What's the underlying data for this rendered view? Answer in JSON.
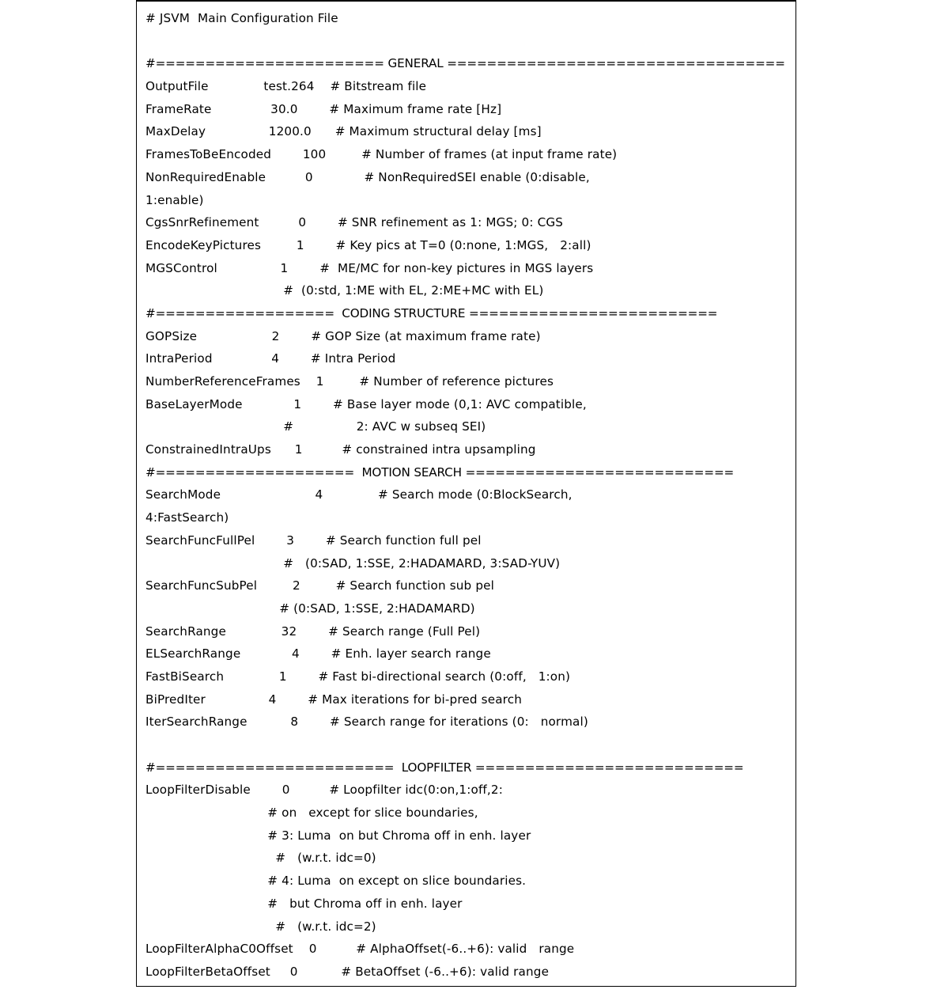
{
  "document": {
    "title": "# JSVM  Main Configuration File",
    "kind": "plain-text-configuration-file",
    "background_color": "#ffffff",
    "text_color": "#000000",
    "border_color": "#000000"
  },
  "lines": [
    {
      "id": "l01",
      "type": "comment",
      "text": "# JSVM  Main Configuration File"
    },
    {
      "id": "l02",
      "type": "blank",
      "text": ""
    },
    {
      "id": "l03",
      "type": "separator",
      "text": "#======================= GENERAL =================================="
    },
    {
      "id": "l04",
      "type": "setting",
      "text": "OutputFile              test.264    # Bitstream file"
    },
    {
      "id": "l05",
      "type": "setting",
      "text": "FrameRate               30.0        # Maximum frame rate [Hz]"
    },
    {
      "id": "l06",
      "type": "setting",
      "text": "MaxDelay                1200.0      # Maximum structural delay [ms]"
    },
    {
      "id": "l07",
      "type": "setting",
      "text": "FramesToBeEncoded        100         # Number of frames (at input frame rate)"
    },
    {
      "id": "l08",
      "type": "setting",
      "text": "NonRequiredEnable          0             # NonRequiredSEI enable (0:disable,"
    },
    {
      "id": "l09",
      "type": "continuation",
      "text": "1:enable)"
    },
    {
      "id": "l10",
      "type": "setting",
      "text": "CgsSnrRefinement          0        # SNR refinement as 1: MGS; 0: CGS"
    },
    {
      "id": "l11",
      "type": "setting",
      "text": "EncodeKeyPictures         1        # Key pics at T=0 (0:none, 1:MGS,   2:all)"
    },
    {
      "id": "l12",
      "type": "setting",
      "text": "MGSControl                1        #  ME/MC for non-key pictures in MGS layers"
    },
    {
      "id": "l13",
      "type": "continuation",
      "text": "                                   #  (0:std, 1:ME with EL, 2:ME+MC with EL)"
    },
    {
      "id": "l14",
      "type": "separator",
      "text": "#==================  CODING STRUCTURE ========================="
    },
    {
      "id": "l15",
      "type": "setting",
      "text": "GOPSize                   2        # GOP Size (at maximum frame rate)"
    },
    {
      "id": "l16",
      "type": "setting",
      "text": "IntraPeriod               4        # Intra Period"
    },
    {
      "id": "l17",
      "type": "setting",
      "text": "NumberReferenceFrames    1         # Number of reference pictures"
    },
    {
      "id": "l18",
      "type": "setting",
      "text": "BaseLayerMode             1        # Base layer mode (0,1: AVC compatible,"
    },
    {
      "id": "l19",
      "type": "continuation",
      "text": "                                   #                2: AVC w subseq SEI)"
    },
    {
      "id": "l20",
      "type": "setting",
      "text": "ConstrainedIntraUps      1          # constrained intra upsampling"
    },
    {
      "id": "l21",
      "type": "separator",
      "text": "#====================  MOTION SEARCH ==========================="
    },
    {
      "id": "l22",
      "type": "setting",
      "text": "SearchMode                        4              # Search mode (0:BlockSearch,"
    },
    {
      "id": "l23",
      "type": "continuation",
      "text": "4:FastSearch)"
    },
    {
      "id": "l24",
      "type": "setting",
      "text": "SearchFuncFullPel        3        # Search function full pel"
    },
    {
      "id": "l25",
      "type": "continuation",
      "text": "                                   #   (0:SAD, 1:SSE, 2:HADAMARD, 3:SAD-YUV)"
    },
    {
      "id": "l26",
      "type": "setting",
      "text": "SearchFuncSubPel         2         # Search function sub pel"
    },
    {
      "id": "l27",
      "type": "continuation",
      "text": "                                  # (0:SAD, 1:SSE, 2:HADAMARD)"
    },
    {
      "id": "l28",
      "type": "setting",
      "text": "SearchRange              32        # Search range (Full Pel)"
    },
    {
      "id": "l29",
      "type": "setting",
      "text": "ELSearchRange             4        # Enh. layer search range"
    },
    {
      "id": "l30",
      "type": "setting",
      "text": "FastBiSearch              1        # Fast bi-directional search (0:off,   1:on)"
    },
    {
      "id": "l31",
      "type": "setting",
      "text": "BiPredIter                4        # Max iterations for bi-pred search"
    },
    {
      "id": "l32",
      "type": "setting",
      "text": "IterSearchRange           8        # Search range for iterations (0:   normal)"
    },
    {
      "id": "l33",
      "type": "blank",
      "text": ""
    },
    {
      "id": "l34",
      "type": "separator",
      "text": "#========================  LOOPFILTER ==========================="
    },
    {
      "id": "l35",
      "type": "setting",
      "text": "LoopFilterDisable        0          # Loopfilter idc(0:on,1:off,2:"
    },
    {
      "id": "l36",
      "type": "continuation",
      "text": "                               # on   except for slice boundaries,"
    },
    {
      "id": "l37",
      "type": "continuation",
      "text": "                               # 3: Luma  on but Chroma off in enh. layer"
    },
    {
      "id": "l38",
      "type": "continuation",
      "text": "                                 #   (w.r.t. idc=0)"
    },
    {
      "id": "l39",
      "type": "continuation",
      "text": "                               # 4: Luma  on except on slice boundaries."
    },
    {
      "id": "l40",
      "type": "continuation",
      "text": "                               #   but Chroma off in enh. layer"
    },
    {
      "id": "l41",
      "type": "continuation",
      "text": "                                 #   (w.r.t. idc=2)"
    },
    {
      "id": "l42",
      "type": "setting",
      "text": "LoopFilterAlphaC0Offset    0          # AlphaOffset(-6..+6): valid   range"
    },
    {
      "id": "l43",
      "type": "setting",
      "text": "LoopFilterBetaOffset     0           # BetaOffset (-6..+6): valid range"
    }
  ],
  "sections": [
    {
      "name": "GENERAL",
      "line_id": "l03"
    },
    {
      "name": "CODING STRUCTURE",
      "line_id": "l14"
    },
    {
      "name": "MOTION SEARCH",
      "line_id": "l21"
    },
    {
      "name": "LOOPFILTER",
      "line_id": "l34"
    }
  ],
  "settings": [
    {
      "key": "OutputFile",
      "value": "test.264",
      "comment": "# Bitstream file"
    },
    {
      "key": "FrameRate",
      "value": "30.0",
      "comment": "# Maximum frame rate [Hz]"
    },
    {
      "key": "MaxDelay",
      "value": "1200.0",
      "comment": "# Maximum structural delay [ms]"
    },
    {
      "key": "FramesToBeEncoded",
      "value": "100",
      "comment": "# Number of frames (at input frame rate)"
    },
    {
      "key": "NonRequiredEnable",
      "value": "0",
      "comment": "# NonRequiredSEI enable (0:disable, 1:enable)"
    },
    {
      "key": "CgsSnrRefinement",
      "value": "0",
      "comment": "# SNR refinement as 1: MGS; 0: CGS"
    },
    {
      "key": "EncodeKeyPictures",
      "value": "1",
      "comment": "# Key pics at T=0 (0:none, 1:MGS, 2:all)"
    },
    {
      "key": "MGSControl",
      "value": "1",
      "comment": "# ME/MC for non-key pictures in MGS layers (0:std, 1:ME with EL, 2:ME+MC with EL)"
    },
    {
      "key": "GOPSize",
      "value": "2",
      "comment": "# GOP Size (at maximum frame rate)"
    },
    {
      "key": "IntraPeriod",
      "value": "4",
      "comment": "# Intra Period"
    },
    {
      "key": "NumberReferenceFrames",
      "value": "1",
      "comment": "# Number of reference pictures"
    },
    {
      "key": "BaseLayerMode",
      "value": "1",
      "comment": "# Base layer mode (0,1: AVC compatible, 2: AVC w subseq SEI)"
    },
    {
      "key": "ConstrainedIntraUps",
      "value": "1",
      "comment": "# constrained intra upsampling"
    },
    {
      "key": "SearchMode",
      "value": "4",
      "comment": "# Search mode (0:BlockSearch, 4:FastSearch)"
    },
    {
      "key": "SearchFuncFullPel",
      "value": "3",
      "comment": "# Search function full pel (0:SAD, 1:SSE, 2:HADAMARD, 3:SAD-YUV)"
    },
    {
      "key": "SearchFuncSubPel",
      "value": "2",
      "comment": "# Search function sub pel (0:SAD, 1:SSE, 2:HADAMARD)"
    },
    {
      "key": "SearchRange",
      "value": "32",
      "comment": "# Search range (Full Pel)"
    },
    {
      "key": "ELSearchRange",
      "value": "4",
      "comment": "# Enh. layer search range"
    },
    {
      "key": "FastBiSearch",
      "value": "1",
      "comment": "# Fast bi-directional search (0:off, 1:on)"
    },
    {
      "key": "BiPredIter",
      "value": "4",
      "comment": "# Max iterations for bi-pred search"
    },
    {
      "key": "IterSearchRange",
      "value": "8",
      "comment": "# Search range for iterations (0: normal)"
    },
    {
      "key": "LoopFilterDisable",
      "value": "0",
      "comment": "# Loopfilter idc(0:on,1:off,2: on except for slice boundaries, 3: Luma on but Chroma off in enh. layer (w.r.t. idc=0) 4: Luma on except on slice boundaries. but Chroma off in enh. layer (w.r.t. idc=2)"
    },
    {
      "key": "LoopFilterAlphaC0Offset",
      "value": "0",
      "comment": "# AlphaOffset(-6..+6): valid range"
    },
    {
      "key": "LoopFilterBetaOffset",
      "value": "0",
      "comment": "# BetaOffset (-6..+6): valid range"
    }
  ]
}
